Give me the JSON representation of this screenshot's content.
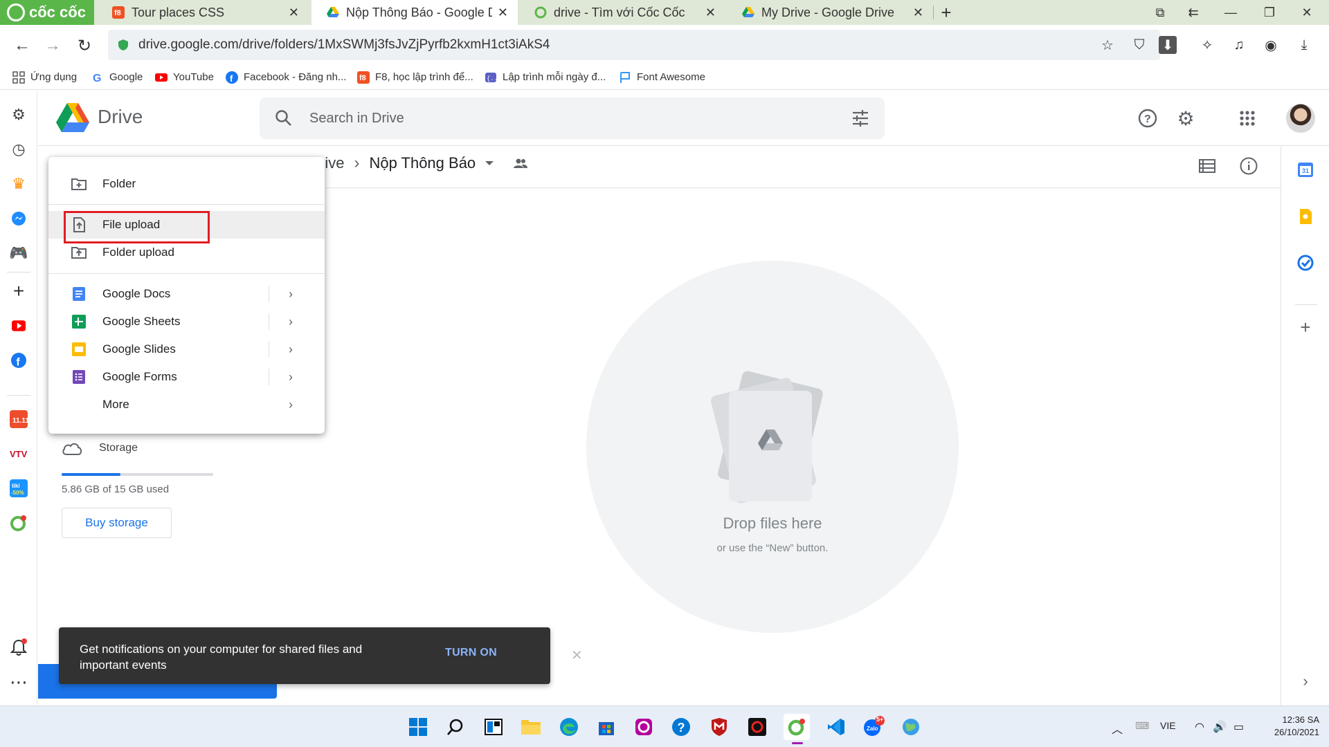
{
  "browser": {
    "brand": "cốc cốc",
    "tabs": [
      {
        "title": "Tour places CSS",
        "active": false
      },
      {
        "title": "Nộp Thông Báo - Google Dri",
        "active": true
      },
      {
        "title": "drive - Tìm với Cốc Cốc",
        "active": false
      },
      {
        "title": "My Drive - Google Drive",
        "active": false
      }
    ],
    "url": "drive.google.com/drive/folders/1MxSWMj3fsJvZjPyrfb2kxmH1ct3iAkS4",
    "bookmarks": [
      {
        "label": "Ứng dụng",
        "icon": "apps-grid-icon"
      },
      {
        "label": "Google",
        "icon": "google-icon"
      },
      {
        "label": "YouTube",
        "icon": "youtube-icon"
      },
      {
        "label": "Facebook - Đăng nh...",
        "icon": "facebook-icon"
      },
      {
        "label": "F8, học lập trình để...",
        "icon": "f8-icon"
      },
      {
        "label": "Lập trình mỗi ngày đ...",
        "icon": "code-icon"
      },
      {
        "label": "Font Awesome",
        "icon": "flag-icon"
      }
    ]
  },
  "drive": {
    "title": "Drive",
    "search_placeholder": "Search in Drive",
    "breadcrumb": {
      "parent": "rive",
      "current": "Nộp Thông Báo"
    },
    "drop_title": "Drop files here",
    "drop_sub": "or use the “New” button.",
    "storage": {
      "label": "Storage",
      "used_text": "5.86 GB of 15 GB used",
      "fraction": 0.39,
      "buy_label": "Buy storage"
    },
    "new_menu": {
      "folder": "Folder",
      "file_upload": "File upload",
      "folder_upload": "Folder upload",
      "docs": "Google Docs",
      "sheets": "Google Sheets",
      "slides": "Google Slides",
      "forms": "Google Forms",
      "more": "More"
    },
    "snackbar": {
      "text": "Get notifications on your computer for shared files and important events",
      "action": "TURN ON"
    }
  },
  "taskbar": {
    "language": "VIE",
    "time": "12:36 SA",
    "date": "26/10/2021",
    "zalo_badge": "5+"
  },
  "colors": {
    "accent": "#1a73e8",
    "highlight_box": "#e11d24",
    "coccoc_green": "#5bb64a"
  }
}
